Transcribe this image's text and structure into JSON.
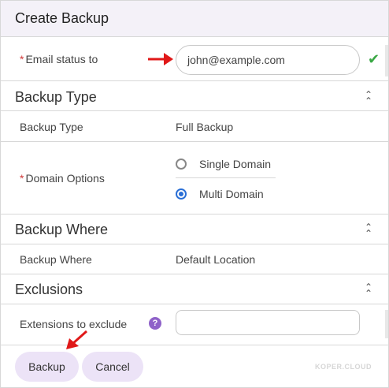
{
  "dialog": {
    "title": "Create Backup"
  },
  "email": {
    "required_mark": "*",
    "label": "Email status to",
    "value": "john@example.com",
    "valid_icon": "check-icon"
  },
  "backup_type_section": {
    "title": "Backup Type",
    "collapse_icon": "chevron-double-up-icon"
  },
  "backup_type": {
    "label": "Backup Type",
    "value": "Full Backup"
  },
  "domain_options": {
    "required_mark": "*",
    "label": "Domain Options",
    "options": [
      {
        "label": "Single Domain",
        "selected": false
      },
      {
        "label": "Multi Domain",
        "selected": true
      }
    ]
  },
  "backup_where_section": {
    "title": "Backup Where",
    "collapse_icon": "chevron-double-up-icon"
  },
  "backup_where": {
    "label": "Backup Where",
    "value": "Default Location"
  },
  "exclusions_section": {
    "title": "Exclusions",
    "collapse_icon": "chevron-double-up-icon"
  },
  "extensions": {
    "label": "Extensions to exclude",
    "help_glyph": "?",
    "value": ""
  },
  "footer": {
    "backup_label": "Backup",
    "cancel_label": "Cancel",
    "brand": "KOPER.CLOUD"
  },
  "colors": {
    "accent": "#2a6fd6",
    "button_bg": "#ece3f7",
    "help_bg": "#8f62c9",
    "annotation_arrow": "#e01818",
    "valid": "#3aa845"
  }
}
